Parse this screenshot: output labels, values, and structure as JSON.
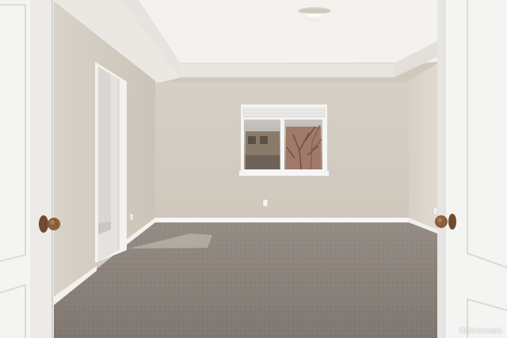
{
  "photo": {
    "subject": "empty-carpeted-bedroom",
    "watermark": "REcolorado"
  },
  "colors": {
    "wall": "#d3ccc2",
    "wall_shadow": "#c6bfb4",
    "ceiling": "#f2f1ee",
    "carpet": "#8b837b",
    "trim": "#f7f6f3",
    "door": "#f4f4f2",
    "knob": "#8a5e3c"
  }
}
